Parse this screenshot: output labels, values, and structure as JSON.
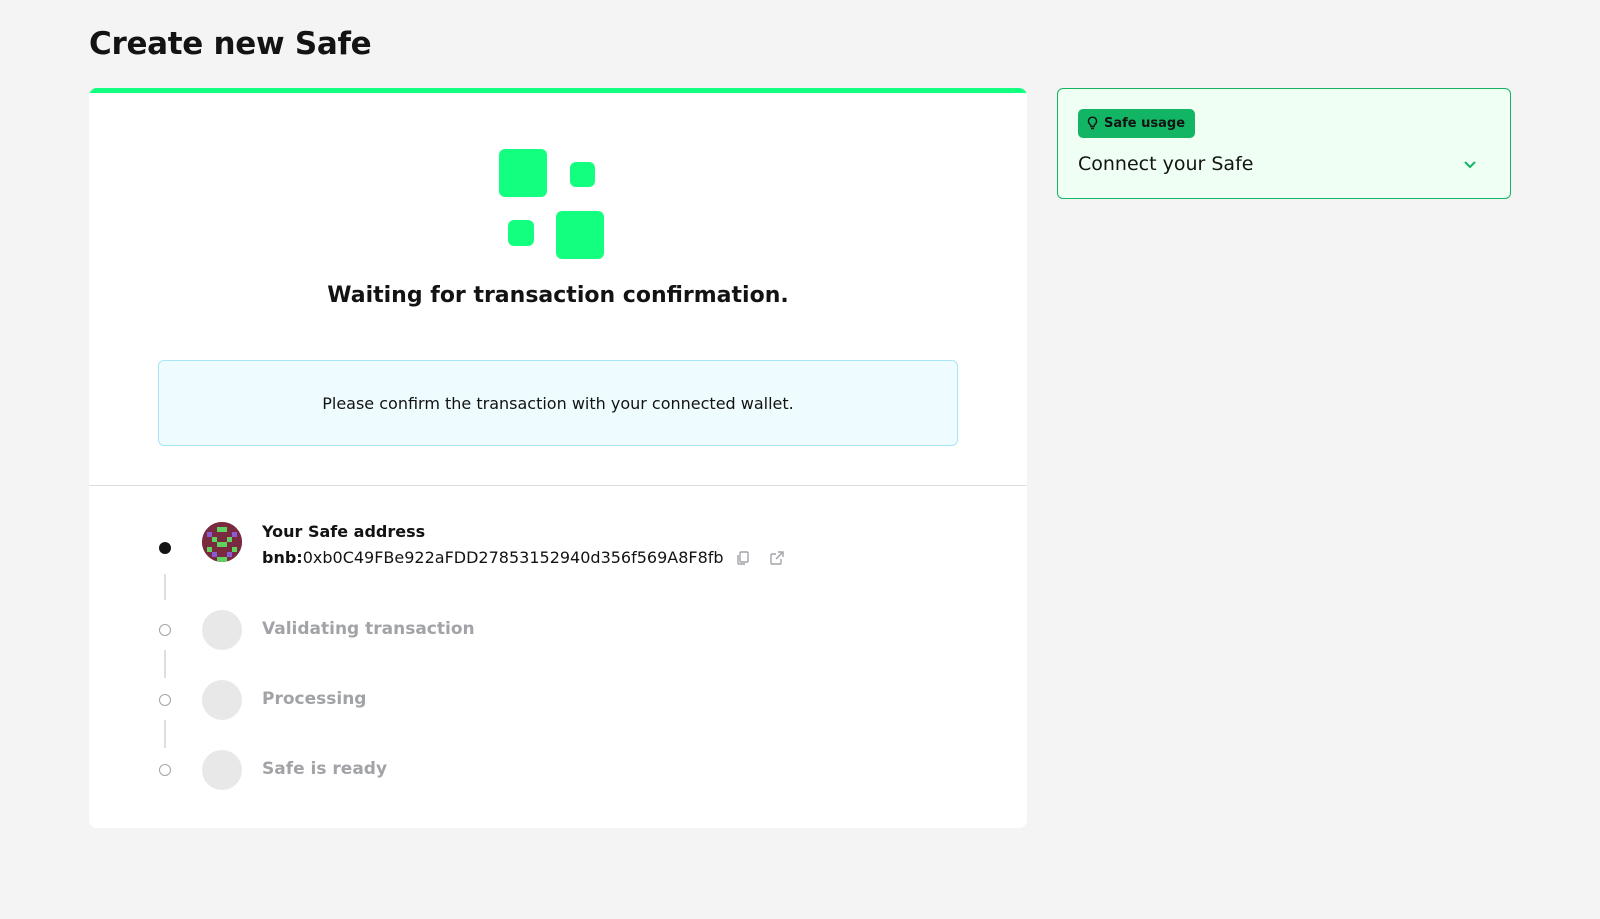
{
  "page": {
    "title": "Create new Safe"
  },
  "progress": {
    "fraction": 1.0,
    "color": "#12ff80"
  },
  "status": {
    "title": "Waiting for transaction confirmation.",
    "info_message": "Please confirm the transaction with your connected wallet."
  },
  "steps": {
    "address": {
      "title": "Your Safe address",
      "prefix": "bnb:",
      "address": "0xb0C49FBe922aFDD27853152940d356f569A8F8fb",
      "copy_icon": "copy-icon",
      "open_icon": "external-link-icon"
    },
    "items": [
      {
        "label": "Validating transaction",
        "state": "pending"
      },
      {
        "label": "Processing",
        "state": "pending"
      },
      {
        "label": "Safe is ready",
        "state": "pending"
      }
    ]
  },
  "sidebar": {
    "badge_label": "Safe usage",
    "badge_icon": "lightbulb-icon",
    "item_label": "Connect your Safe",
    "expand_icon": "chevron-down-icon"
  },
  "colors": {
    "brand_green": "#12ff80",
    "accent_green": "#12b564",
    "info_bg": "#effcff",
    "pending_gray": "#a1a3a7"
  }
}
